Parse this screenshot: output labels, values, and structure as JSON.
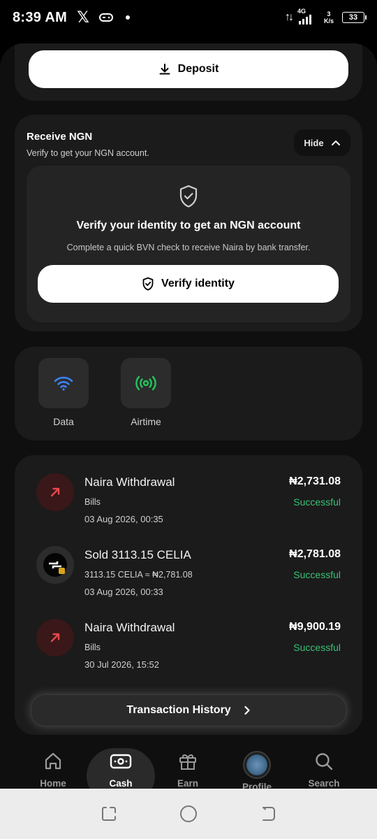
{
  "status_bar": {
    "time": "8:39 AM",
    "x_logo": "𝕏",
    "network_type": "4G",
    "speed_value": "3",
    "speed_unit": "K/s",
    "battery": "33"
  },
  "deposit": {
    "label": "Deposit"
  },
  "receive": {
    "title": "Receive NGN",
    "subtitle": "Verify to get your NGN account.",
    "hide_label": "Hide",
    "verify_title": "Verify your identity to get an NGN account",
    "verify_subtitle": "Complete a quick BVN check to receive Naira by bank transfer.",
    "verify_button": "Verify identity"
  },
  "services": [
    {
      "label": "Data",
      "icon": "wifi-icon",
      "color": "#3b82f6"
    },
    {
      "label": "Airtime",
      "icon": "broadcast-icon",
      "color": "#22c55e"
    }
  ],
  "transactions": [
    {
      "title": "Naira Withdrawal",
      "subtitle": "Bills",
      "date": "03 Aug 2026, 00:35",
      "amount": "₦2,731.08",
      "status": "Successful",
      "type": "withdraw"
    },
    {
      "title": "Sold 3113.15 CELIA",
      "subtitle": "3113.15 CELIA ≈ ₦2,781.08",
      "date": "03 Aug 2026, 00:33",
      "amount": "₦2,781.08",
      "status": "Successful",
      "type": "sold"
    },
    {
      "title": "Naira Withdrawal",
      "subtitle": "Bills",
      "date": "30 Jul 2026, 15:52",
      "amount": "₦9,900.19",
      "status": "Successful",
      "type": "withdraw"
    }
  ],
  "history_button": "Transaction History",
  "nav": [
    {
      "label": "Home",
      "icon": "home-icon",
      "active": false
    },
    {
      "label": "Cash",
      "icon": "cash-icon",
      "active": true
    },
    {
      "label": "Earn",
      "icon": "gift-icon",
      "active": false
    },
    {
      "label": "Profile",
      "icon": "avatar",
      "active": false
    },
    {
      "label": "Search",
      "icon": "search-icon",
      "active": false
    }
  ],
  "colors": {
    "success": "#37c275",
    "withdraw_arrow": "#e5484d",
    "accent_blue": "#3b82f6",
    "accent_green": "#22c55e"
  }
}
